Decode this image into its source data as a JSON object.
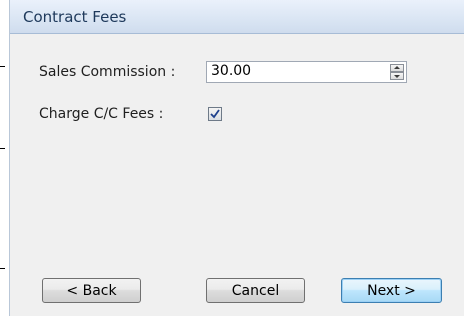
{
  "header": {
    "title": "Contract Fees"
  },
  "form": {
    "sales_commission_label": "Sales Commission :",
    "sales_commission_value": "30.00",
    "charge_cc_fees_label": "Charge C/C Fees :",
    "charge_cc_fees_checked": true
  },
  "buttons": {
    "back": "< Back",
    "cancel": "Cancel",
    "next": "Next >"
  },
  "icons": {
    "spin_up": "arrow-up-icon",
    "spin_down": "arrow-down-icon",
    "checkmark": "checkmark-icon"
  }
}
